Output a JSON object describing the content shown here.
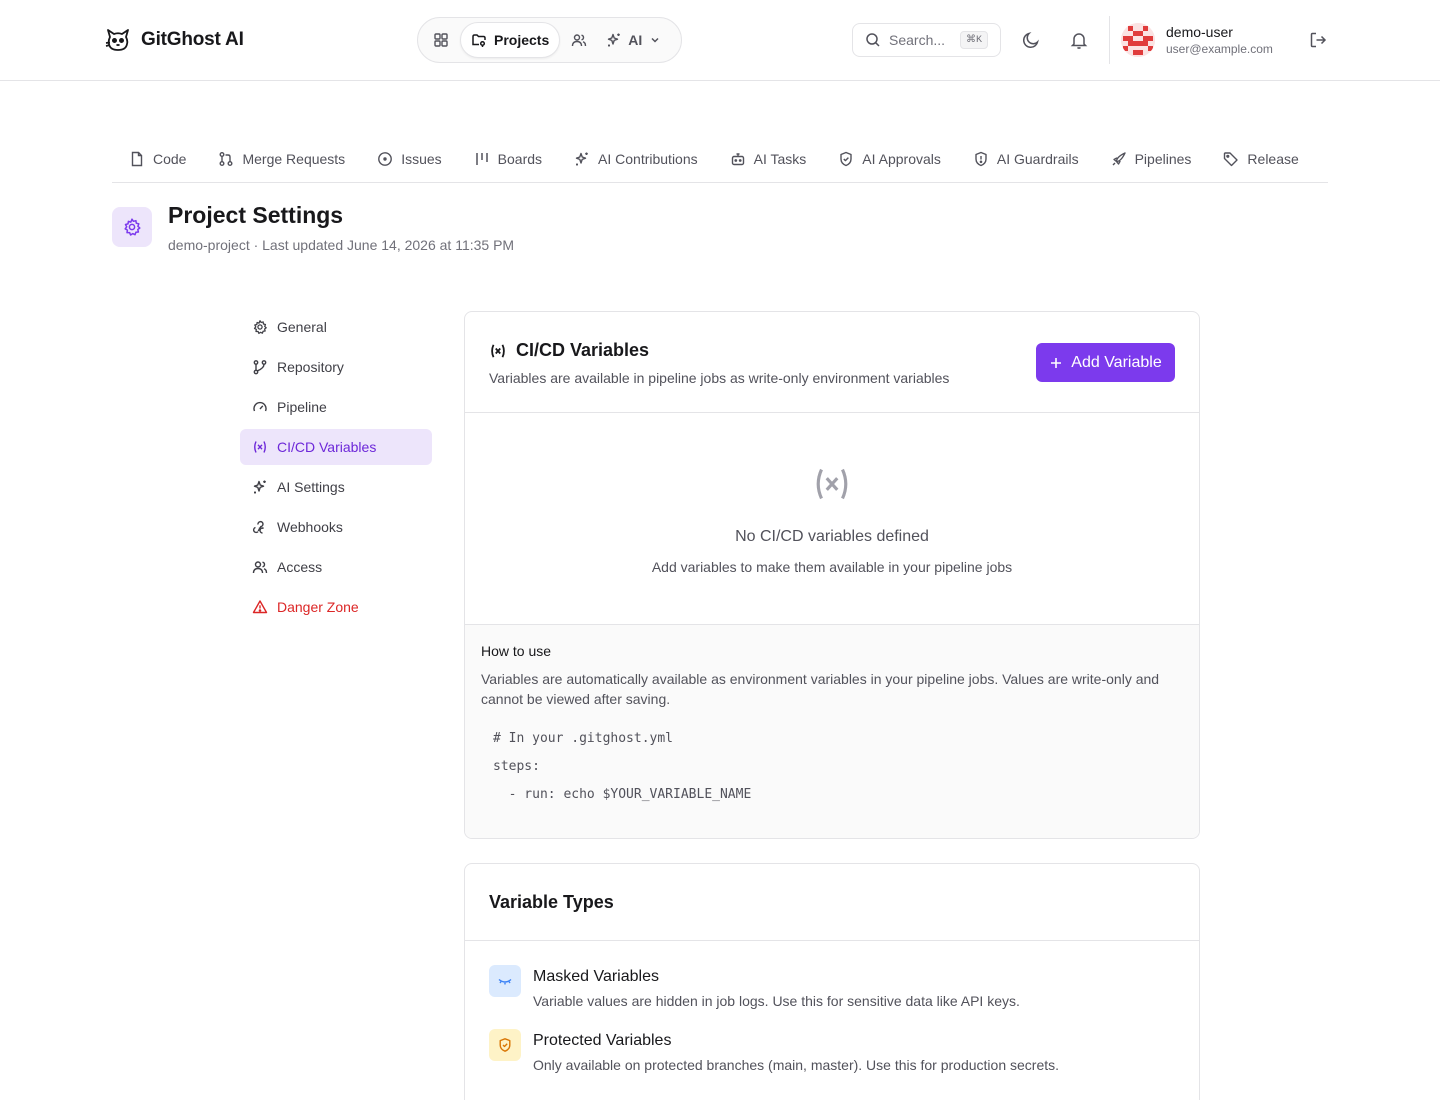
{
  "brand": {
    "name": "GitGhost AI"
  },
  "topnav": {
    "projects_label": "Projects",
    "ai_label": "AI"
  },
  "search": {
    "placeholder": "Search...",
    "shortcut": "⌘K"
  },
  "user": {
    "name": "demo-user",
    "email": "user@example.com"
  },
  "tabs": [
    {
      "label": "Code",
      "icon": "file-icon"
    },
    {
      "label": "Merge Requests",
      "icon": "git-pull-request-icon"
    },
    {
      "label": "Issues",
      "icon": "circle-dot-icon"
    },
    {
      "label": "Boards",
      "icon": "kanban-icon"
    },
    {
      "label": "AI Contributions",
      "icon": "sparkles-icon"
    },
    {
      "label": "AI Tasks",
      "icon": "bot-icon"
    },
    {
      "label": "AI Approvals",
      "icon": "shield-check-icon"
    },
    {
      "label": "AI Guardrails",
      "icon": "shield-alert-icon"
    },
    {
      "label": "Pipelines",
      "icon": "rocket-icon"
    },
    {
      "label": "Release",
      "icon": "tag-icon"
    }
  ],
  "page": {
    "title": "Project Settings",
    "subtitle": "demo-project · Last updated June 14, 2026 at 11:35 PM"
  },
  "sidebar": {
    "items": [
      {
        "label": "General",
        "icon": "gear-icon"
      },
      {
        "label": "Repository",
        "icon": "git-branch-icon"
      },
      {
        "label": "Pipeline",
        "icon": "gauge-icon"
      },
      {
        "label": "CI/CD Variables",
        "icon": "variable-icon",
        "active": true
      },
      {
        "label": "AI Settings",
        "icon": "sparkles-icon"
      },
      {
        "label": "Webhooks",
        "icon": "webhook-icon"
      },
      {
        "label": "Access",
        "icon": "users-icon"
      },
      {
        "label": "Danger Zone",
        "icon": "warning-icon",
        "danger": true
      }
    ]
  },
  "variables_card": {
    "title": "CI/CD Variables",
    "description": "Variables are available in pipeline jobs as write-only environment variables",
    "add_label": "Add Variable",
    "empty_title": "No CI/CD variables defined",
    "empty_desc": "Add variables to make them available in your pipeline jobs",
    "howto_title": "How to use",
    "howto_desc": "Variables are automatically available as environment variables in your pipeline jobs. Values are write-only and cannot be viewed after saving.",
    "code": "# In your .gitghost.yml\nsteps:\n  - run: echo $YOUR_VARIABLE_NAME"
  },
  "types_card": {
    "title": "Variable Types",
    "items": [
      {
        "title": "Masked Variables",
        "desc": "Variable values are hidden in job logs. Use this for sensitive data like API keys.",
        "icon": "eye-off-icon",
        "color": "#dbeafe"
      },
      {
        "title": "Protected Variables",
        "desc": "Only available on protected branches (main, master). Use this for production secrets.",
        "icon": "shield-icon",
        "color": "#fef3c7"
      }
    ]
  },
  "colors": {
    "accent": "#7c3aed",
    "danger": "#dc2626",
    "accent_soft": "#ede5fb"
  }
}
